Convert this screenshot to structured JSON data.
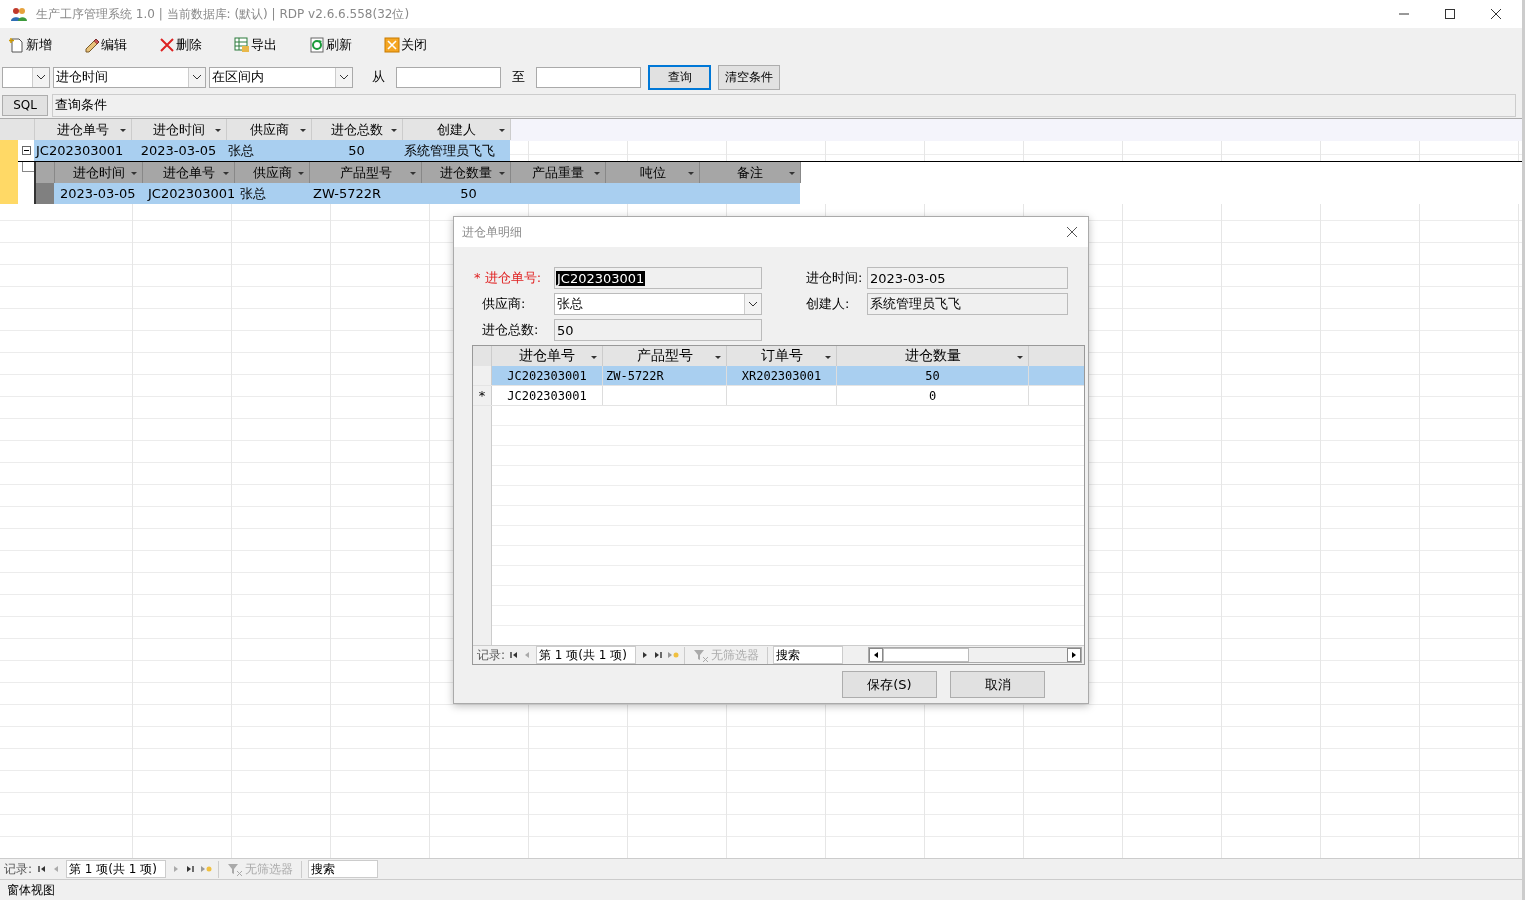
{
  "window": {
    "title": "生产工序管理系统 1.0 | 当前数据库: (默认) | RDP v2.6.6.558(32位)"
  },
  "toolbar": [
    {
      "label": "新增",
      "kind": "new"
    },
    {
      "label": "编辑",
      "kind": "edit"
    },
    {
      "label": "删除",
      "kind": "delete"
    },
    {
      "label": "导出",
      "kind": "export"
    },
    {
      "label": "刷新",
      "kind": "refresh"
    },
    {
      "label": "关闭",
      "kind": "close"
    }
  ],
  "filter": {
    "column": "进仓时间",
    "operator": "在区间内",
    "from_label": "从",
    "to_label": "至",
    "query_button": "查询",
    "clear_button": "清空条件"
  },
  "sql": {
    "button": "SQL",
    "condition": "查询条件"
  },
  "master_grid": {
    "columns": [
      "进仓单号",
      "进仓时间",
      "供应商",
      "进仓总数",
      "创建人"
    ],
    "rows": [
      {
        "cells": [
          "JC202303001",
          "2023-03-05",
          "张总",
          "50",
          "系统管理员飞飞"
        ],
        "selected": true,
        "current": true,
        "expanded": true
      }
    ]
  },
  "detail_grid": {
    "columns": [
      "进仓时间",
      "进仓单号",
      "供应商",
      "产品型号",
      "进仓数量",
      "产品重量",
      "吨位",
      "备注"
    ],
    "rows": [
      {
        "cells": [
          "2023-03-05",
          "JC202303001",
          "张总",
          "ZW-5722R",
          "50",
          null,
          null,
          null
        ],
        "selected": true
      }
    ]
  },
  "navigator": {
    "label": "记录:",
    "position": "第 1 项(共 1 项)",
    "filter": "无筛选器",
    "search": "搜索"
  },
  "status_bar": "窗体视图",
  "dialog": {
    "title": "进仓单明细",
    "fields": [
      {
        "label": "* 进仓单号:",
        "value": "JC202303001",
        "kind": "text",
        "required": true,
        "text_selected": true
      },
      {
        "label": "进仓时间:",
        "value": "2023-03-05",
        "kind": "text",
        "required": false
      },
      {
        "label": "供应商:",
        "value": "张总",
        "kind": "combo",
        "required": false
      },
      {
        "label": "创建人:",
        "value": "系统管理员飞飞",
        "kind": "text",
        "required": false
      },
      {
        "label": "进仓总数:",
        "value": "50",
        "kind": "text",
        "required": false
      }
    ],
    "grid": {
      "columns": [
        "进仓单号",
        "产品型号",
        "订单号",
        "进仓数量"
      ],
      "rows": [
        {
          "cells": [
            "JC202303001",
            "ZW-5722R",
            "XR202303001",
            "50"
          ],
          "selected": true
        },
        {
          "cells": [
            "JC202303001",
            null,
            null,
            "0"
          ],
          "selected": false,
          "marker": "*"
        }
      ]
    },
    "navigator": {
      "label": "记录:",
      "position": "第 1 项(共 1 项)",
      "filter": "无筛选器",
      "search": "搜索"
    },
    "buttons": [
      "保存(S)",
      "取消"
    ]
  }
}
